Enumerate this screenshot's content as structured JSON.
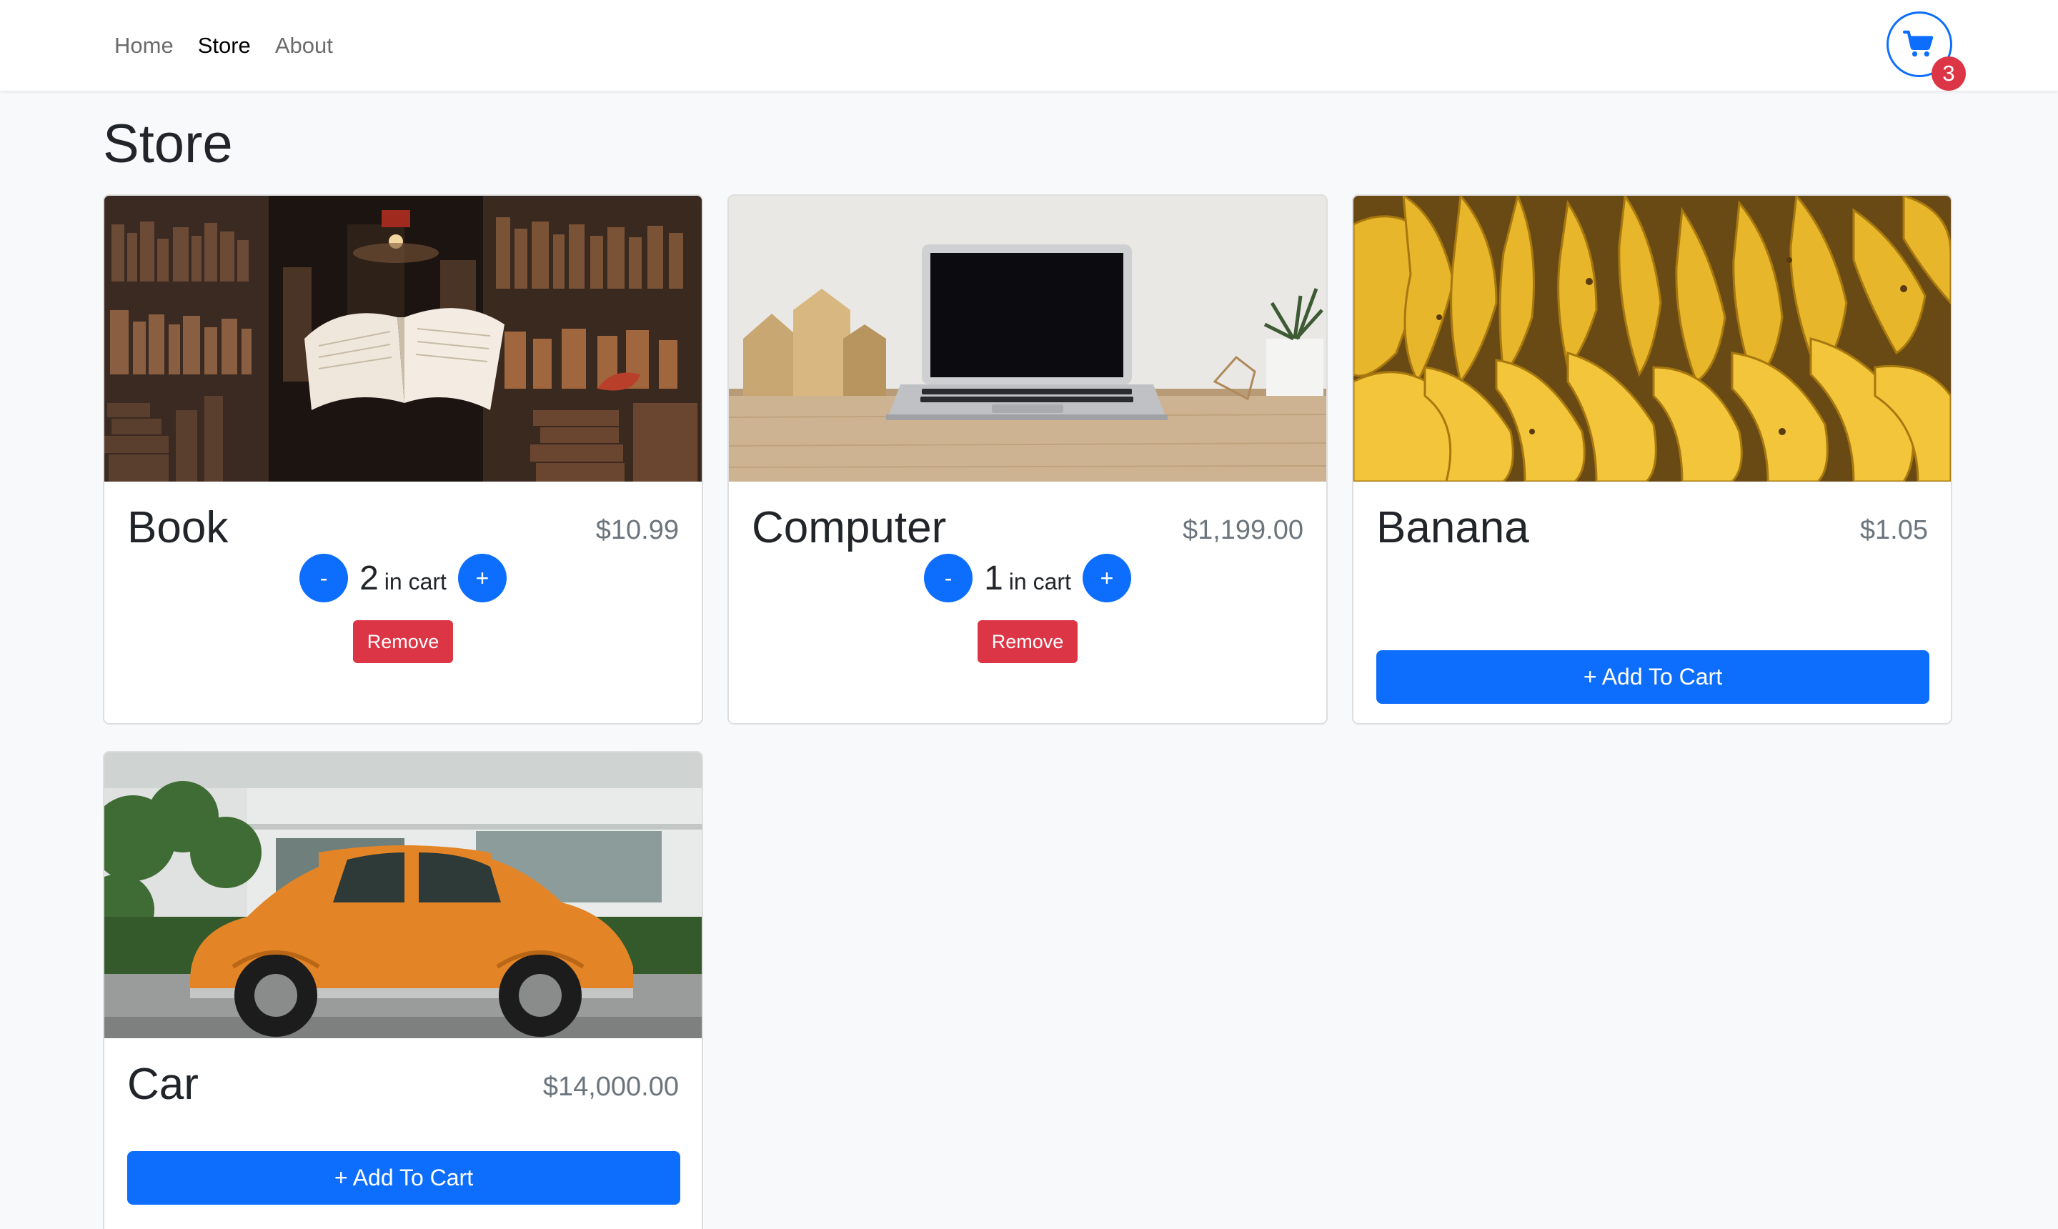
{
  "nav": {
    "links": [
      {
        "label": "Home",
        "active": false
      },
      {
        "label": "Store",
        "active": true
      },
      {
        "label": "About",
        "active": false
      }
    ],
    "cart": {
      "icon": "cart-icon",
      "count": "3",
      "badge_color": "#dc3545",
      "accent": "#0d6efd"
    }
  },
  "page": {
    "title": "Store"
  },
  "products": [
    {
      "name": "Book",
      "price": "$10.99",
      "image": "open-book-in-library",
      "quantity": "2",
      "in_cart_label": "in cart",
      "decrement_label": "-",
      "increment_label": "+",
      "remove_label": "Remove"
    },
    {
      "name": "Computer",
      "price": "$1,199.00",
      "image": "laptop-on-desk",
      "quantity": "1",
      "in_cart_label": "in cart",
      "decrement_label": "-",
      "increment_label": "+",
      "remove_label": "Remove"
    },
    {
      "name": "Banana",
      "price": "$1.05",
      "image": "bunches-of-bananas",
      "add_label": "+ Add To Cart"
    },
    {
      "name": "Car",
      "price": "$14,000.00",
      "image": "orange-vintage-beetle-car",
      "add_label": "+ Add To Cart"
    }
  ]
}
